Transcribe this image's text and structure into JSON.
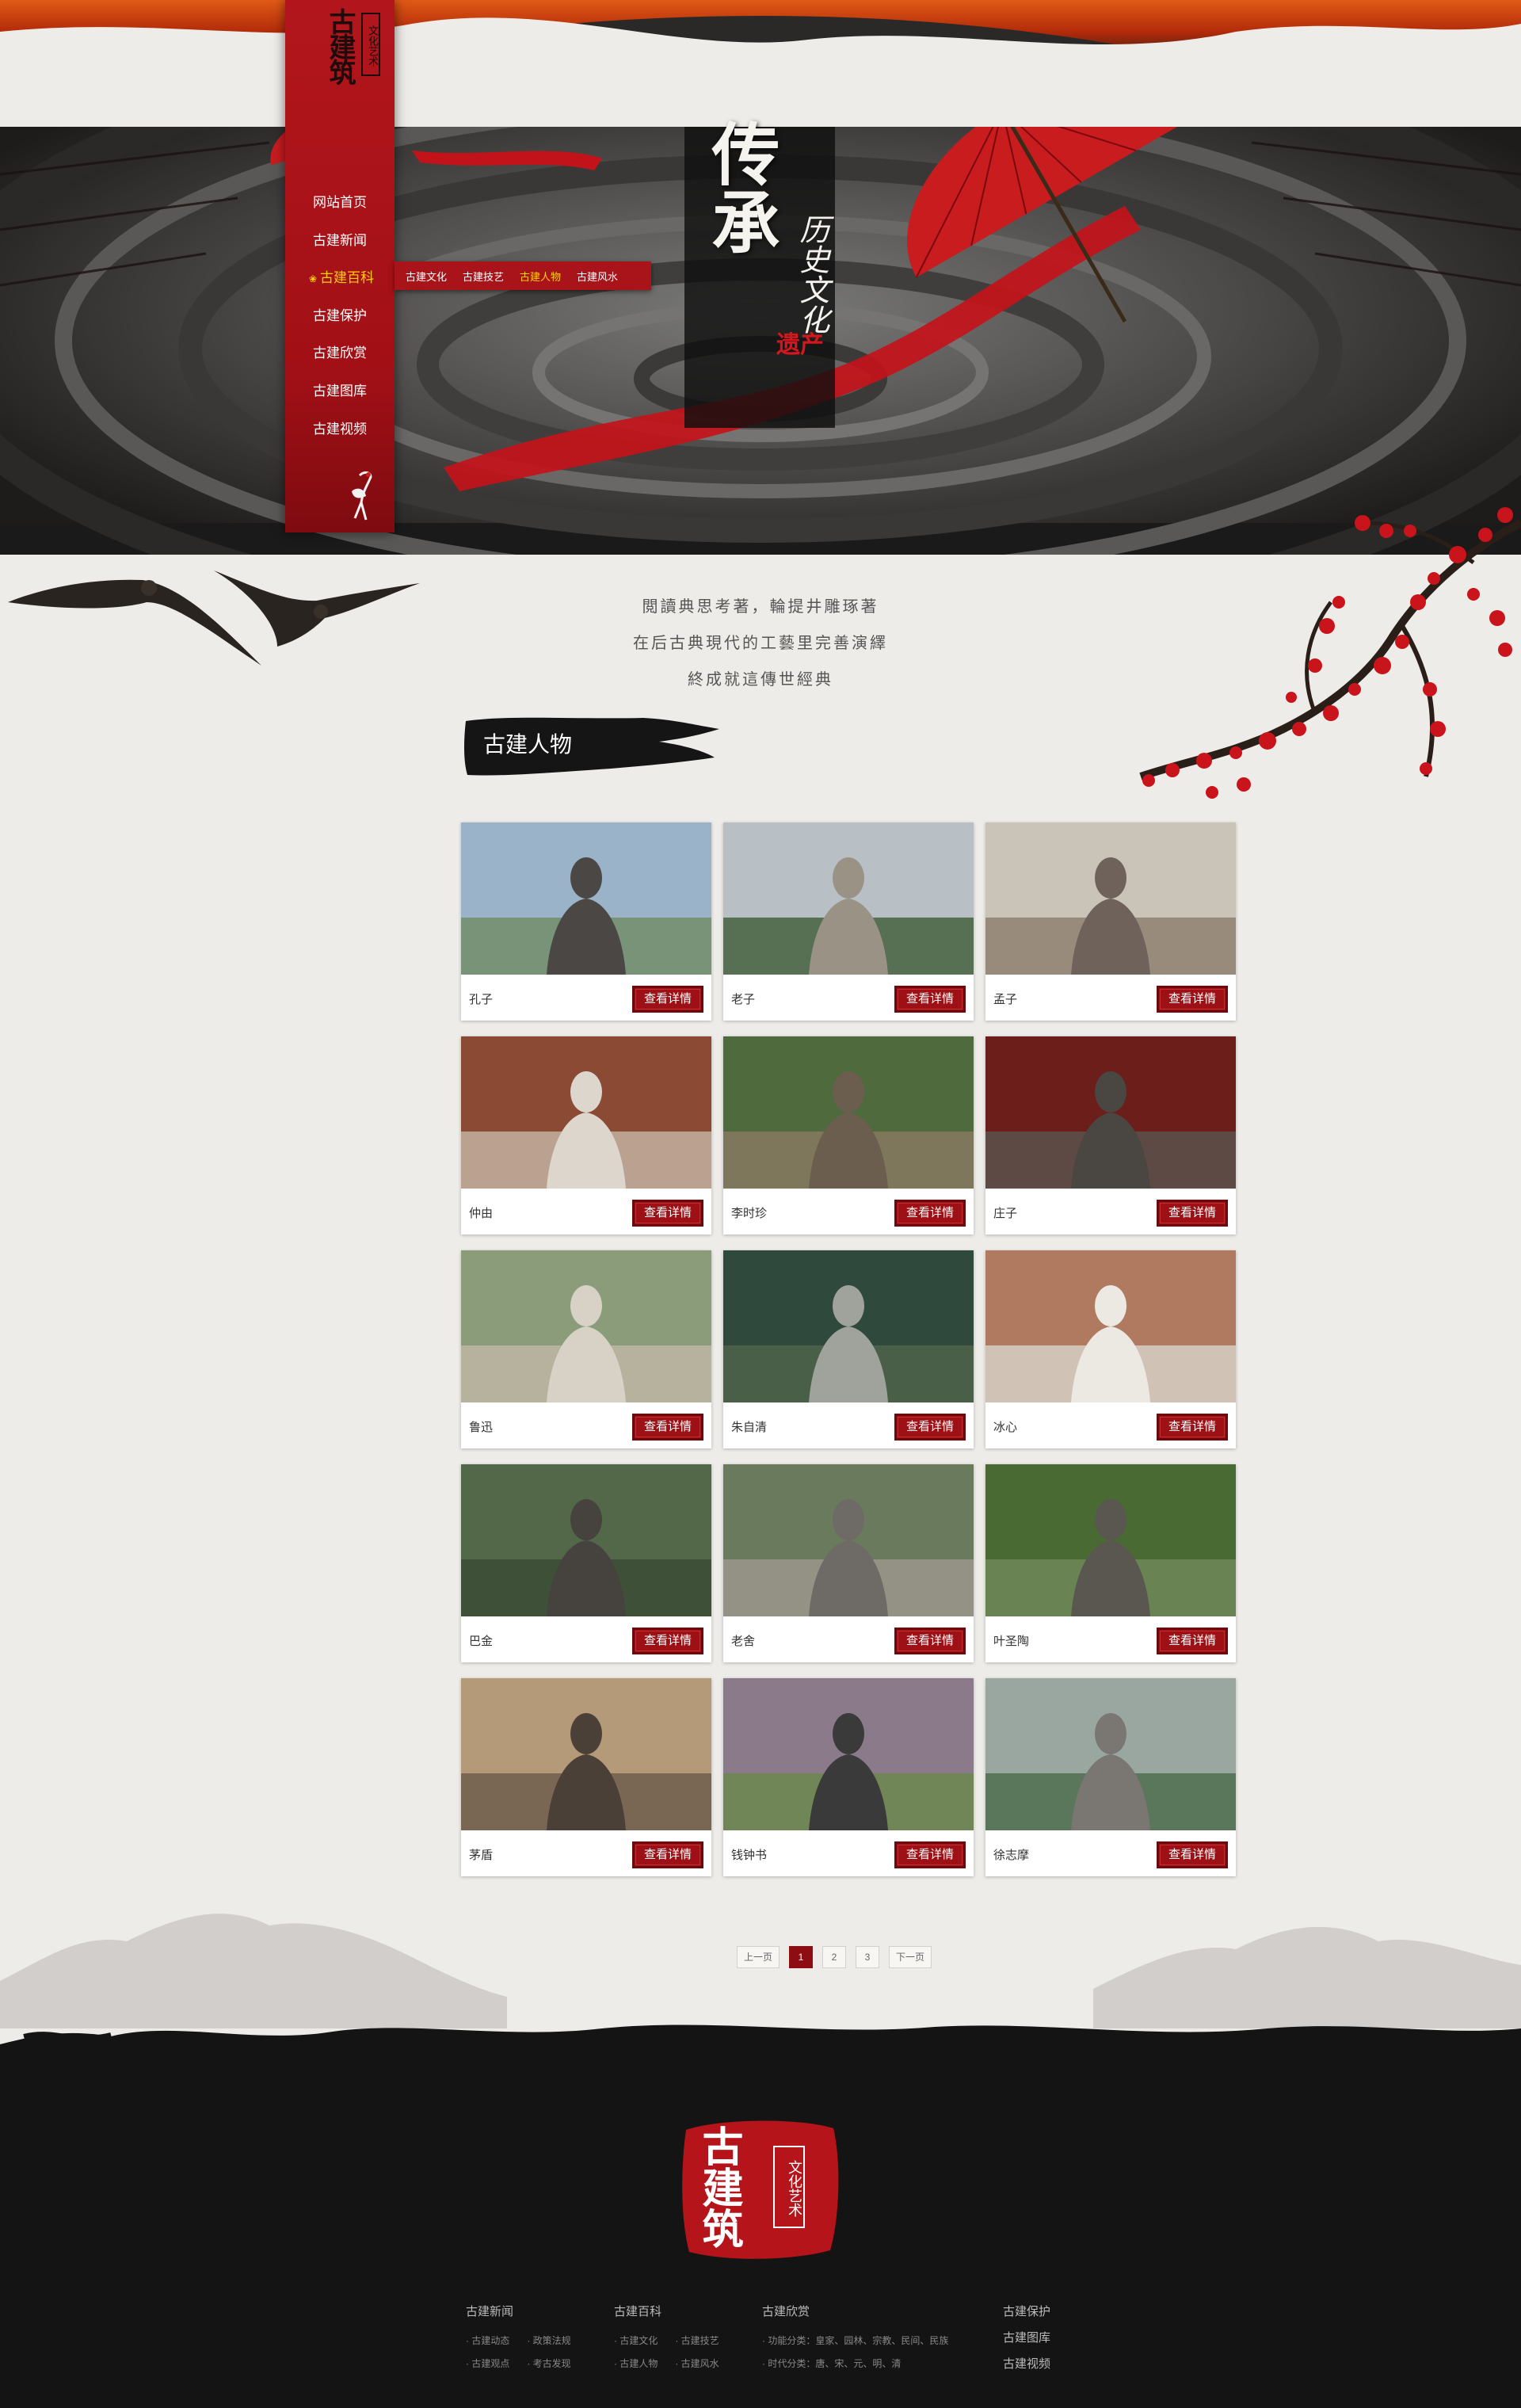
{
  "brand": {
    "logo_main": "古建筑",
    "logo_seal": "文化艺术"
  },
  "nav": {
    "items": [
      {
        "label": "网站首页"
      },
      {
        "label": "古建新闻"
      },
      {
        "label": "古建百科",
        "active": true
      },
      {
        "label": "古建保护"
      },
      {
        "label": "古建欣赏"
      },
      {
        "label": "古建图库"
      },
      {
        "label": "古建视频"
      }
    ],
    "sub_items": [
      {
        "label": "古建文化"
      },
      {
        "label": "古建技艺"
      },
      {
        "label": "古建人物",
        "active": true
      },
      {
        "label": "古建风水"
      }
    ]
  },
  "hero": {
    "title_main": "传承",
    "title_sub": "历史文化",
    "title_red": "遗产"
  },
  "poem": {
    "line1": "閲讀典思考著，輪提井雕琢著",
    "line2": "在后古典現代的工藝里完善演繹",
    "line3": "終成就這傳世經典"
  },
  "section": {
    "title": "古建人物"
  },
  "cards": [
    {
      "name": "孔子",
      "button": "查看详情"
    },
    {
      "name": "老子",
      "button": "查看详情"
    },
    {
      "name": "孟子",
      "button": "查看详情"
    },
    {
      "name": "仲由",
      "button": "查看详情"
    },
    {
      "name": "李时珍",
      "button": "查看详情"
    },
    {
      "name": "庄子",
      "button": "查看详情"
    },
    {
      "name": "鲁迅",
      "button": "查看详情"
    },
    {
      "name": "朱自清",
      "button": "查看详情"
    },
    {
      "name": "冰心",
      "button": "查看详情"
    },
    {
      "name": "巴金",
      "button": "查看详情"
    },
    {
      "name": "老舍",
      "button": "查看详情"
    },
    {
      "name": "叶圣陶",
      "button": "查看详情"
    },
    {
      "name": "茅盾",
      "button": "查看详情"
    },
    {
      "name": "钱钟书",
      "button": "查看详情"
    },
    {
      "name": "徐志摩",
      "button": "查看详情"
    }
  ],
  "pagination": {
    "prev": "上一页",
    "pages": [
      "1",
      "2",
      "3"
    ],
    "current": "1",
    "next": "下一页"
  },
  "footer": {
    "logo_main": "古建筑",
    "logo_seal": "文化艺术",
    "col_news": {
      "title": "古建新闻",
      "links_a": [
        "· 古建动态",
        "· 古建观点"
      ],
      "links_b": [
        "· 政策法规",
        "· 考古发现"
      ]
    },
    "col_wiki": {
      "title": "古建百科",
      "links_a": [
        "· 古建文化",
        "· 古建人物"
      ],
      "links_b": [
        "· 古建技艺",
        "· 古建风水"
      ]
    },
    "col_appreciate": {
      "title": "古建欣赏",
      "links_a": [
        "· 功能分类：皇家、园林、宗教、民间、民族",
        "· 时代分类：唐、宋、元、明、清"
      ]
    },
    "col_other": [
      "古建保护",
      "古建图库",
      "古建视频"
    ]
  },
  "colors": {
    "brand_red": "#a8141a",
    "active_yellow": "#ffd200",
    "footer_bg": "#141414",
    "page_bg": "#eeece8"
  }
}
